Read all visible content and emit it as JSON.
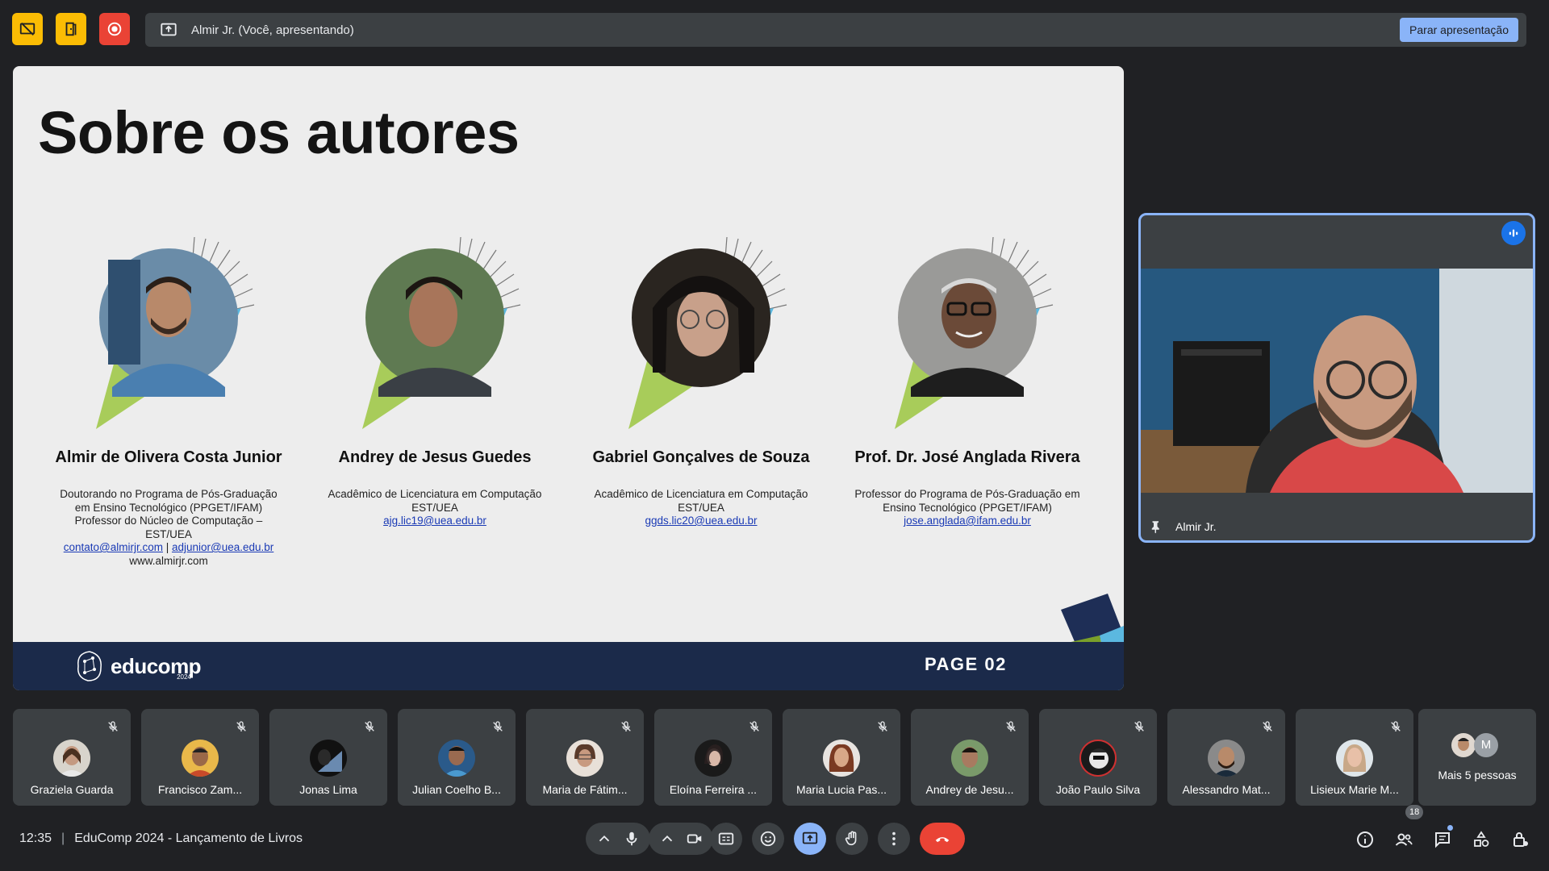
{
  "topbar": {
    "presenting_label": "Almir Jr. (Você, apresentando)",
    "stop_button": "Parar apresentação",
    "colors": {
      "yellow": "#fbbc04",
      "red": "#ea4335",
      "accent": "#8ab4f8"
    }
  },
  "slide": {
    "title": "Sobre os autores",
    "authors": [
      {
        "name": "Almir de Olivera Costa Junior",
        "lines": [
          "Doutorando no Programa de Pós-Graduação",
          "em Ensino Tecnológico (PPGET/IFAM)",
          "Professor do Núcleo de Computação –",
          "EST/UEA"
        ],
        "links": [
          "contato@almirjr.com",
          "adjunior@uea.edu.br"
        ],
        "website": "www.almirjr.com"
      },
      {
        "name": "Andrey de Jesus Guedes",
        "lines": [
          "Acadêmico de Licenciatura em Computação",
          "EST/UEA"
        ],
        "links": [
          "ajg.lic19@uea.edu.br"
        ]
      },
      {
        "name": "Gabriel Gonçalves de Souza",
        "lines": [
          "Acadêmico de Licenciatura em Computação",
          "EST/UEA"
        ],
        "links": [
          "ggds.lic20@uea.edu.br"
        ]
      },
      {
        "name": "Prof. Dr. José Anglada Rivera",
        "lines": [
          "Professor do Programa de Pós-Graduação em",
          "Ensino Tecnológico (PPGET/IFAM)"
        ],
        "links": [
          "jose.anglada@ifam.edu.br"
        ]
      }
    ],
    "footer": {
      "logo": "educomp",
      "logo_year": "2024",
      "page": "PAGE 02"
    }
  },
  "self_tile": {
    "name": "Almir Jr."
  },
  "participants": [
    {
      "name": "Graziela Guarda"
    },
    {
      "name": "Francisco Zam..."
    },
    {
      "name": "Jonas Lima"
    },
    {
      "name": "Julian Coelho B..."
    },
    {
      "name": "Maria de Fátim..."
    },
    {
      "name": "Eloína Ferreira ..."
    },
    {
      "name": "Maria Lucia Pas..."
    },
    {
      "name": "Andrey de Jesu..."
    },
    {
      "name": "João Paulo Silva"
    },
    {
      "name": "Alessandro Mat..."
    },
    {
      "name": "Lisieux Marie M..."
    }
  ],
  "more_people": {
    "label": "Mais 5 pessoas",
    "initial": "M"
  },
  "bottombar": {
    "time": "12:35",
    "separator": "|",
    "meeting_title": "EduComp 2024 - Lançamento de Livros",
    "people_count": "18"
  }
}
